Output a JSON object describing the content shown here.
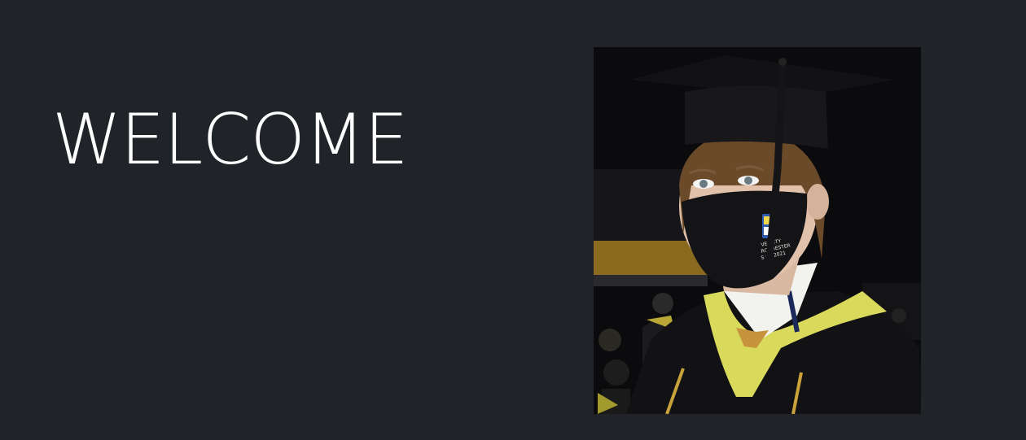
{
  "hero": {
    "heading": "WELCOME",
    "photo": {
      "subject": "graduate-portrait",
      "mask_lines": [
        "VERSITY",
        "ROCHESTER",
        "S OF 2021"
      ]
    }
  },
  "colors": {
    "background": "#202328",
    "heading_text": "#ffffff",
    "hood_yellow": "#d8d85a",
    "gown_black": "#101012"
  }
}
